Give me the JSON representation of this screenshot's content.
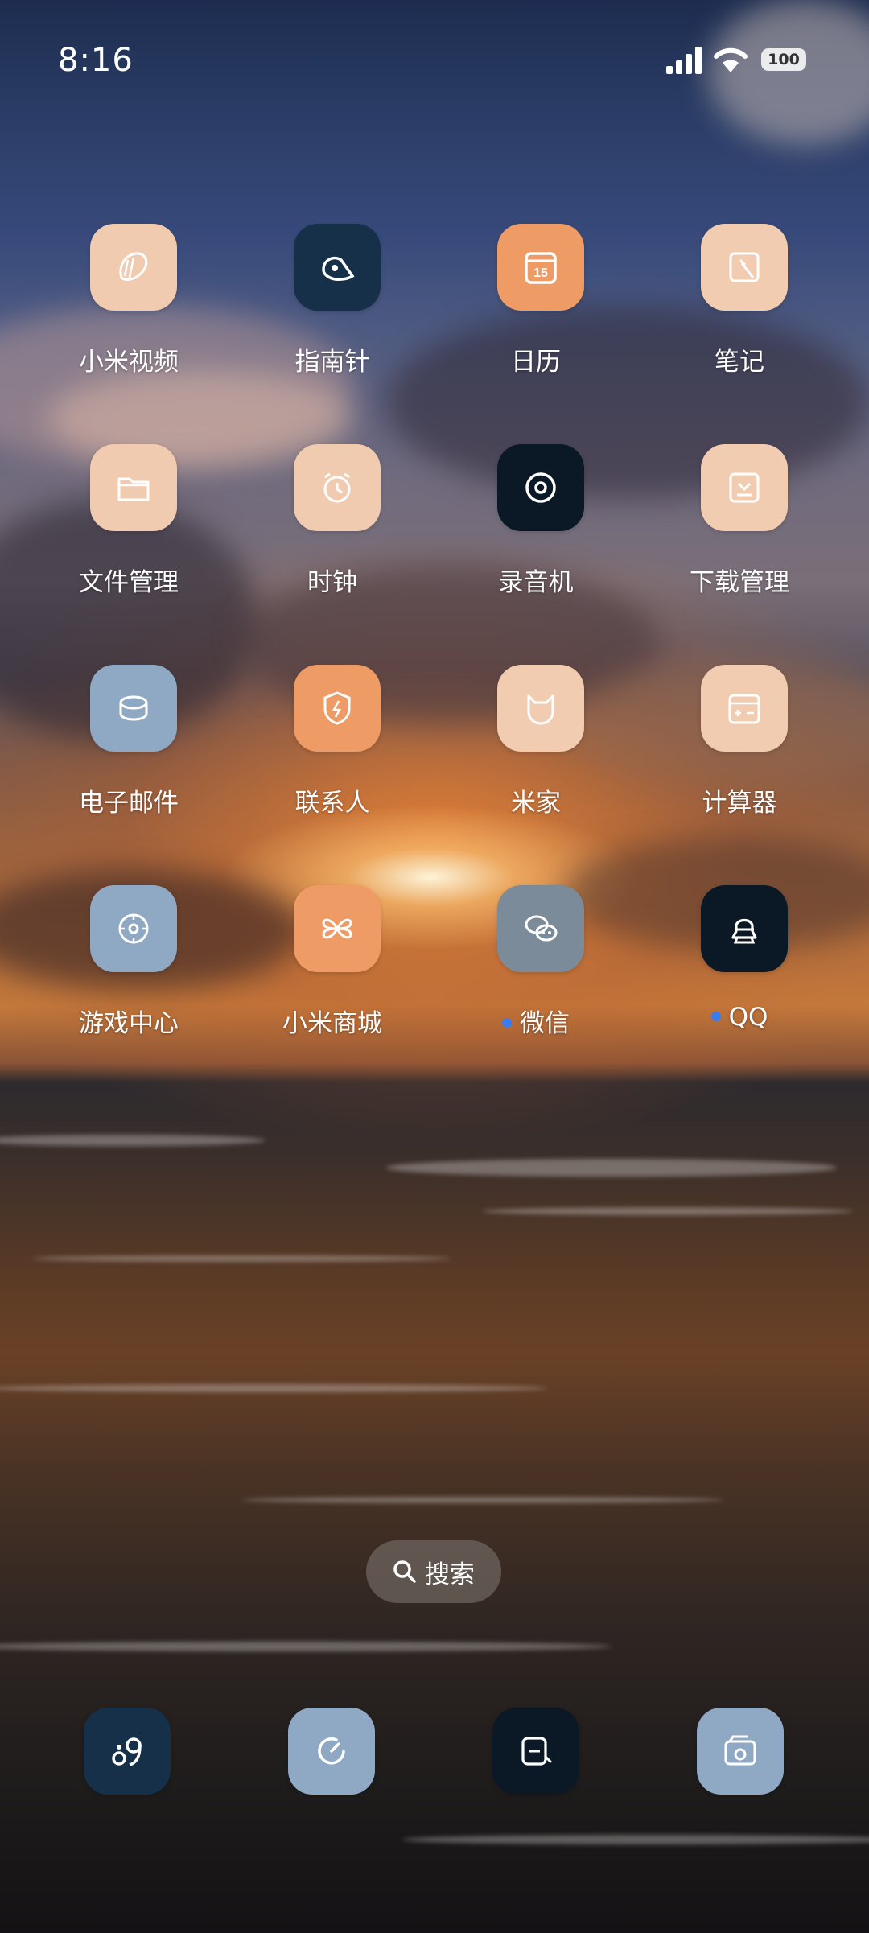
{
  "status_bar": {
    "time": "8:16",
    "battery": "100",
    "signal_icon": "cellular-signal-icon",
    "wifi_icon": "wifi-icon"
  },
  "apps": [
    {
      "label": "小米视频",
      "icon": "video-icon",
      "color": "#f0cbb0",
      "dot": false
    },
    {
      "label": "指南针",
      "icon": "compass-icon",
      "color": "#163049",
      "dot": false
    },
    {
      "label": "日历",
      "icon": "calendar-icon",
      "color": "#ee9b66",
      "dot": false,
      "icon_text": "15"
    },
    {
      "label": "笔记",
      "icon": "notes-icon",
      "color": "#f1ccb1",
      "dot": false
    },
    {
      "label": "文件管理",
      "icon": "folder-icon",
      "color": "#f0cbb0",
      "dot": false
    },
    {
      "label": "时钟",
      "icon": "clock-icon",
      "color": "#f0cbb0",
      "dot": false
    },
    {
      "label": "录音机",
      "icon": "recorder-icon",
      "color": "#0b1826",
      "dot": false
    },
    {
      "label": "下载管理",
      "icon": "download-icon",
      "color": "#f1ccb1",
      "dot": false
    },
    {
      "label": "电子邮件",
      "icon": "email-icon",
      "color": "#8fa9c4",
      "dot": false
    },
    {
      "label": "联系人",
      "icon": "contacts-icon",
      "color": "#ee9b66",
      "dot": false
    },
    {
      "label": "米家",
      "icon": "mijia-icon",
      "color": "#f1ccb1",
      "dot": false
    },
    {
      "label": "计算器",
      "icon": "calculator-icon",
      "color": "#f1ccb1",
      "dot": false
    },
    {
      "label": "游戏中心",
      "icon": "game-center-icon",
      "color": "#8fa9c4",
      "dot": false
    },
    {
      "label": "小米商城",
      "icon": "mi-store-icon",
      "color": "#ee9b66",
      "dot": false
    },
    {
      "label": "微信",
      "icon": "wechat-icon",
      "color": "#7c8b99",
      "dot": true
    },
    {
      "label": "QQ",
      "icon": "qq-icon",
      "color": "#0b1826",
      "dot": true
    }
  ],
  "search": {
    "label": "搜索",
    "icon": "search-icon"
  },
  "dock": [
    {
      "icon": "phone-app-icon",
      "color": "#163049"
    },
    {
      "icon": "browser-icon",
      "color": "#8fa9c4"
    },
    {
      "icon": "messages-icon",
      "color": "#0b1826"
    },
    {
      "icon": "camera-icon",
      "color": "#8fa9c4"
    }
  ]
}
